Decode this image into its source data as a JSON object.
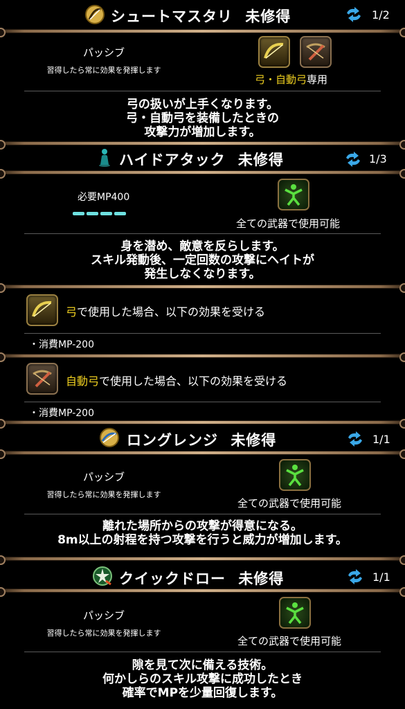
{
  "skills": [
    {
      "name": "シュートマスタリ",
      "status": "未修得",
      "level": "1/2",
      "passive_label": "パッシブ",
      "passive_desc": "習得したら常に効果を発揮します",
      "weapon_text_a": "弓・自動弓",
      "weapon_text_b": "専用",
      "description": [
        "弓の扱いが上手くなります。",
        "弓・自動弓を装備したときの",
        "攻撃力が増加します。"
      ]
    },
    {
      "name": "ハイドアタック",
      "status": "未修得",
      "level": "1/3",
      "mp_required": "必要MP400",
      "usable": "全ての武器で使用可能",
      "description": [
        "身を潜め、敵意を反らします。",
        "スキル発動後、一定回数の攻撃にヘイトが",
        "発生しなくなります。"
      ],
      "bow_note_weapon": "弓",
      "bow_note_rest": "で使用した場合、以下の効果を受ける",
      "bow_effect": "・消費MP-200",
      "crossbow_note_weapon": "自動弓",
      "crossbow_note_rest": "で使用した場合、以下の効果を受ける",
      "crossbow_effect": "・消費MP-200"
    },
    {
      "name": "ロングレンジ",
      "status": "未修得",
      "level": "1/1",
      "passive_label": "パッシブ",
      "passive_desc": "習得したら常に効果を発揮します",
      "usable": "全ての武器で使用可能",
      "description": [
        "離れた場所からの攻撃が得意になる。",
        "8m以上の射程を持つ攻撃を行うと威力が増加します。"
      ]
    },
    {
      "name": "クイックドロー",
      "status": "未修得",
      "level": "1/1",
      "passive_label": "パッシブ",
      "passive_desc": "習得したら常に効果を発揮します",
      "usable": "全ての武器で使用可能",
      "description": [
        "隙を見て次に備える技術。",
        "何かしらのスキル攻撃に成功したとき",
        "確率でMPを少量回復します。"
      ]
    }
  ],
  "icons": {
    "skill1": "bow-skill-icon",
    "skill2": "hide-attack-icon",
    "skill3": "long-range-icon",
    "skill4": "quick-draw-icon",
    "level": "cycle-icon",
    "bow": "bow-icon",
    "crossbow": "crossbow-icon",
    "all_weapons": "all-weapons-icon"
  },
  "colors": {
    "accent_yellow": "#f0d020",
    "mp_bar": "#6ee0e0",
    "cycle_blue": "#3aa8e8"
  }
}
